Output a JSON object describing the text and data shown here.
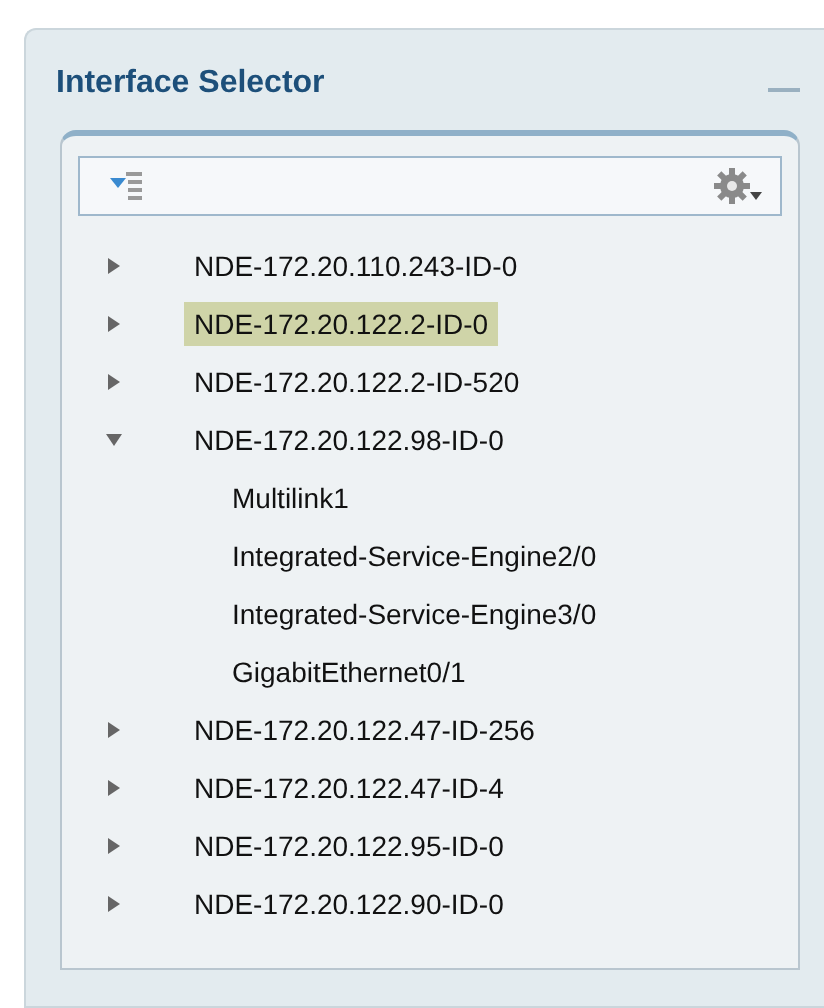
{
  "panel": {
    "title": "Interface Selector"
  },
  "tree": [
    {
      "label": "NDE-172.20.110.243-ID-0",
      "selected": false,
      "expanded": false
    },
    {
      "label": "NDE-172.20.122.2-ID-0",
      "selected": true,
      "expanded": false
    },
    {
      "label": "NDE-172.20.122.2-ID-520",
      "selected": false,
      "expanded": false
    },
    {
      "label": "NDE-172.20.122.98-ID-0",
      "selected": false,
      "expanded": true,
      "children": [
        {
          "label": "Multilink1",
          "selected": false
        },
        {
          "label": "Integrated-Service-Engine2/0",
          "selected": false
        },
        {
          "label": "Integrated-Service-Engine3/0",
          "selected": false
        },
        {
          "label": "GigabitEthernet0/1",
          "selected": false
        }
      ]
    },
    {
      "label": "NDE-172.20.122.47-ID-256",
      "selected": false,
      "expanded": false
    },
    {
      "label": "NDE-172.20.122.47-ID-4",
      "selected": false,
      "expanded": false
    },
    {
      "label": "NDE-172.20.122.95-ID-0",
      "selected": false,
      "expanded": false
    },
    {
      "label": "NDE-172.20.122.90-ID-0",
      "selected": false,
      "expanded": false
    }
  ]
}
